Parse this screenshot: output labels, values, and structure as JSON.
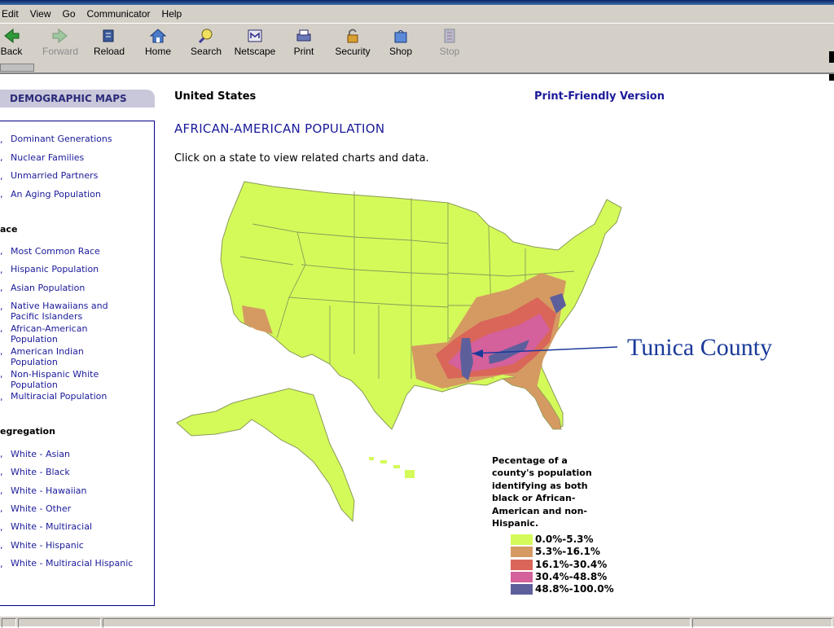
{
  "menu": [
    "Edit",
    "View",
    "Go",
    "Communicator",
    "Help"
  ],
  "toolbar": {
    "back": "Back",
    "forward": "Forward",
    "reload": "Reload",
    "home": "Home",
    "search": "Search",
    "netscape": "Netscape",
    "print": "Print",
    "security": "Security",
    "shop": "Shop",
    "stop": "Stop"
  },
  "sidebar": {
    "heading": "DEMOGRAPHIC MAPS",
    "group1": [
      "Dominant Generations",
      "Nuclear Families",
      "Unmarried Partners",
      "An Aging Population"
    ],
    "race_heading": "ace",
    "race": [
      "Most Common Race",
      "Hispanic Population",
      "Asian Population",
      "Native Hawaiians and",
      "Pacific Islanders",
      "African-American",
      "Population",
      "American Indian",
      "Population",
      "Non-Hispanic White",
      "Population",
      "Multiracial Population"
    ],
    "seg_heading": "egregation",
    "segregation": [
      "White - Asian",
      "White - Black",
      "White - Hawaiian",
      "White - Other",
      "White - Multiracial",
      "White - Hispanic",
      "White - Multiracial Hispanic"
    ]
  },
  "content": {
    "country": "United States",
    "print_link": "Print-Friendly Version",
    "map_title": "AFRICAN-AMERICAN POPULATION",
    "instruction": "Click on a state to view related charts and data.",
    "annotation": "Tunica County"
  },
  "legend": {
    "title_lines": [
      "Pecentage of a",
      "county's population",
      "identifying as both",
      "black or African-",
      "American and non-",
      "Hispanic."
    ],
    "items": [
      {
        "label": "0.0%-5.3%",
        "color": "#d4fa5a"
      },
      {
        "label": "5.3%-16.1%",
        "color": "#d59a62"
      },
      {
        "label": "16.1%-30.4%",
        "color": "#d96659"
      },
      {
        "label": "30.4%-48.8%",
        "color": "#d4609c"
      },
      {
        "label": "48.8%-100.0%",
        "color": "#5d5f9c"
      }
    ]
  },
  "colors": {
    "link": "#1a1a9a",
    "map_base": "#d4fa5a",
    "state_line": "#8a9a58"
  }
}
